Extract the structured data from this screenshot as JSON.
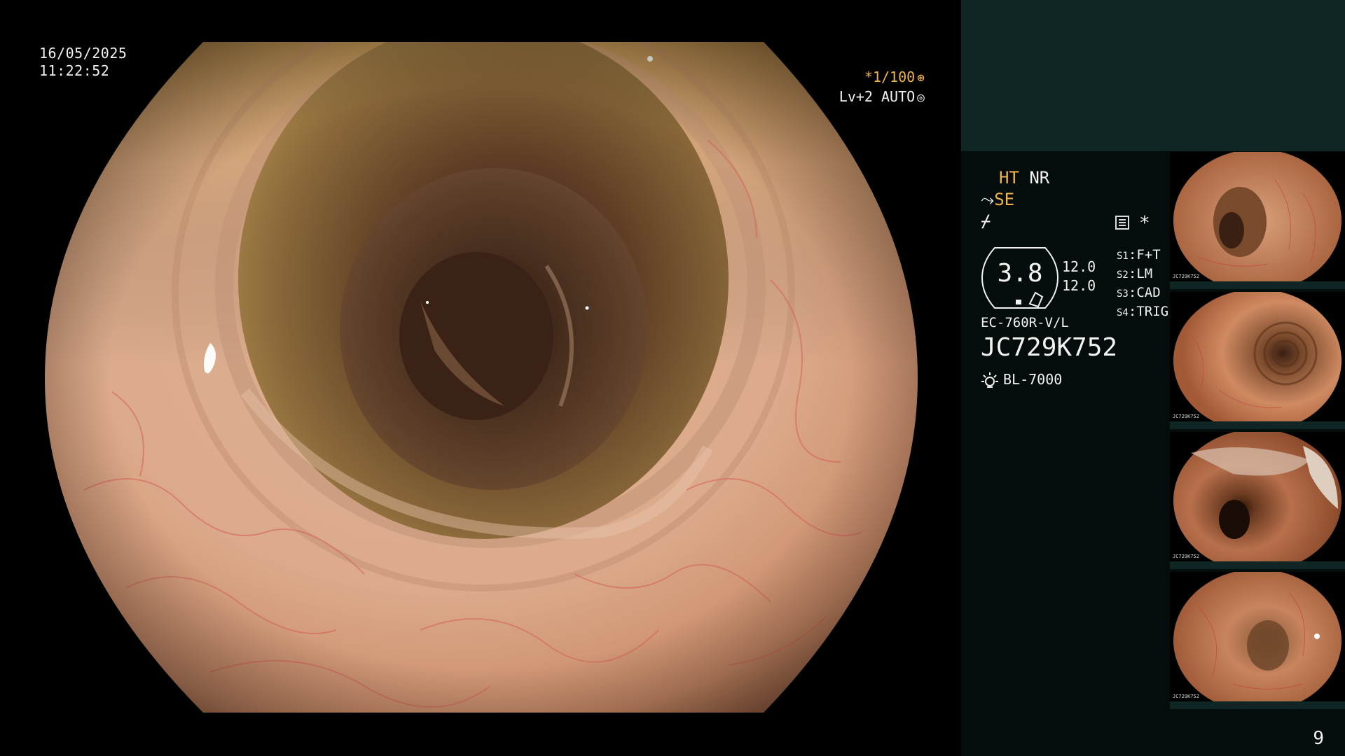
{
  "overlay": {
    "date": "16/05/2025",
    "time": "11:22:52",
    "shutter": "*1/100",
    "level": "Lv+2 AUTO"
  },
  "panel": {
    "ht": "HT",
    "nr": "NR",
    "se": "SE",
    "badge_value": "3.8",
    "nums": [
      "12.0",
      "12.0"
    ],
    "slots": [
      {
        "key": "S1",
        "value": "F+T"
      },
      {
        "key": "S2",
        "value": "LM"
      },
      {
        "key": "S3",
        "value": "CAD"
      },
      {
        "key": "S4",
        "value": "TRIG"
      }
    ],
    "scope_model": "EC-760R-V/L",
    "serial": "JC729K752",
    "light_source": "BL-7000",
    "page_number": "9"
  },
  "colors": {
    "accent_amber": "#f0b24a",
    "panel_top": "#0f2624",
    "panel_bg": "#040d0b"
  },
  "thumbnails": [
    {
      "id": 1,
      "label": "JC729K752"
    },
    {
      "id": 2,
      "label": "JC729K752"
    },
    {
      "id": 3,
      "label": "JC729K752"
    },
    {
      "id": 4,
      "label": "JC729K752"
    }
  ]
}
